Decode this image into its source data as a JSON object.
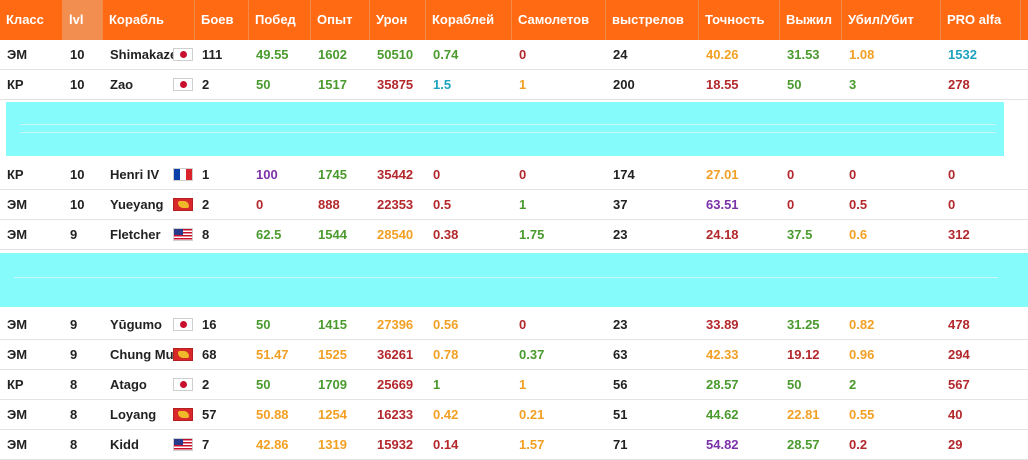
{
  "header": [
    "Класс",
    "lvl",
    "Корабль",
    "Боев",
    "Побед",
    "Опыт",
    "Урон",
    "Кораблей",
    "Самолетов",
    "выстрелов",
    "Точность",
    "Выжил",
    "Убил/Убит",
    "PRO alfa"
  ],
  "rows": [
    {
      "cls": "ЭМ",
      "lvl": "10",
      "ship": "Shimakaze",
      "flag": "jp-flag",
      "battles": "111",
      "wins": "49.55",
      "xp": "1602",
      "dmg": "50510",
      "ships": "0.74",
      "planes": "0",
      "shots": "24",
      "acc": "40.26",
      "surv": "31.53",
      "kd": "1.08",
      "pro": "1532"
    },
    {
      "cls": "КР",
      "lvl": "10",
      "ship": "Zao",
      "flag": "jp-flag",
      "battles": "2",
      "wins": "50",
      "xp": "1517",
      "dmg": "35875",
      "ships": "1.5",
      "planes": "1",
      "shots": "200",
      "acc": "18.55",
      "surv": "50",
      "kd": "3",
      "pro": "278"
    },
    {
      "cls": "КР",
      "lvl": "10",
      "ship": "Henri IV",
      "flag": "fr-flag",
      "battles": "1",
      "wins": "100",
      "xp": "1745",
      "dmg": "35442",
      "ships": "0",
      "planes": "0",
      "shots": "174",
      "acc": "27.01",
      "surv": "0",
      "kd": "0",
      "pro": "0"
    },
    {
      "cls": "ЭМ",
      "lvl": "10",
      "ship": "Yueyang",
      "flag": "cn-flag",
      "battles": "2",
      "wins": "0",
      "xp": "888",
      "dmg": "22353",
      "ships": "0.5",
      "planes": "1",
      "shots": "37",
      "acc": "63.51",
      "surv": "0",
      "kd": "0.5",
      "pro": "0"
    },
    {
      "cls": "ЭМ",
      "lvl": "9",
      "ship": "Fletcher",
      "flag": "us-flag",
      "battles": "8",
      "wins": "62.5",
      "xp": "1544",
      "dmg": "28540",
      "ships": "0.38",
      "planes": "1.75",
      "shots": "23",
      "acc": "24.18",
      "surv": "37.5",
      "kd": "0.6",
      "pro": "312"
    },
    {
      "cls": "ЭМ",
      "lvl": "9",
      "ship": "Yūgumo",
      "flag": "jp-flag",
      "battles": "16",
      "wins": "50",
      "xp": "1415",
      "dmg": "27396",
      "ships": "0.56",
      "planes": "0",
      "shots": "23",
      "acc": "33.89",
      "surv": "31.25",
      "kd": "0.82",
      "pro": "478"
    },
    {
      "cls": "ЭМ",
      "lvl": "9",
      "ship": "Chung Mu",
      "flag": "cn-flag",
      "battles": "68",
      "wins": "51.47",
      "xp": "1525",
      "dmg": "36261",
      "ships": "0.78",
      "planes": "0.37",
      "shots": "63",
      "acc": "42.33",
      "surv": "19.12",
      "kd": "0.96",
      "pro": "294"
    },
    {
      "cls": "КР",
      "lvl": "8",
      "ship": "Atago",
      "flag": "jp-flag",
      "battles": "2",
      "wins": "50",
      "xp": "1709",
      "dmg": "25669",
      "ships": "1",
      "planes": "1",
      "shots": "56",
      "acc": "28.57",
      "surv": "50",
      "kd": "2",
      "pro": "567"
    },
    {
      "cls": "ЭМ",
      "lvl": "8",
      "ship": "Loyang",
      "flag": "cn-flag",
      "battles": "57",
      "wins": "50.88",
      "xp": "1254",
      "dmg": "16233",
      "ships": "0.42",
      "planes": "0.21",
      "shots": "51",
      "acc": "44.62",
      "surv": "22.81",
      "kd": "0.55",
      "pro": "40"
    },
    {
      "cls": "ЭМ",
      "lvl": "8",
      "ship": "Kidd",
      "flag": "us-flag",
      "battles": "7",
      "wins": "42.86",
      "xp": "1319",
      "dmg": "15932",
      "ships": "0.14",
      "planes": "1.57",
      "shots": "71",
      "acc": "54.82",
      "surv": "28.57",
      "kd": "0.2",
      "pro": "29"
    }
  ],
  "colors": {
    "header_bg": "#ff6a13",
    "header_text": "#ffffff",
    "green": "#4a9a2e",
    "darkred": "#b3282d",
    "orange": "#f2a024",
    "purple": "#7b32a8",
    "teal": "#1ea3bf",
    "glitch": "#86fbfb"
  },
  "cell_colors": [
    {
      "wins": "green",
      "xp": "green",
      "dmg": "green",
      "ships": "green",
      "planes": "darkred",
      "acc": "orange",
      "surv": "green",
      "kd": "orange",
      "pro": "teal"
    },
    {
      "wins": "green",
      "xp": "green",
      "dmg": "darkred",
      "ships": "teal",
      "planes": "orange",
      "acc": "darkred",
      "surv": "green",
      "kd": "green",
      "pro": "darkred"
    },
    {
      "wins": "purple",
      "xp": "green",
      "dmg": "darkred",
      "ships": "darkred",
      "planes": "darkred",
      "acc": "orange",
      "surv": "darkred",
      "kd": "darkred",
      "pro": "darkred"
    },
    {
      "wins": "darkred",
      "xp": "darkred",
      "dmg": "darkred",
      "ships": "darkred",
      "planes": "green",
      "acc": "purple",
      "surv": "darkred",
      "kd": "darkred",
      "pro": "darkred"
    },
    {
      "wins": "green",
      "xp": "green",
      "dmg": "orange",
      "ships": "darkred",
      "planes": "green",
      "acc": "darkred",
      "surv": "green",
      "kd": "orange",
      "pro": "darkred"
    },
    {
      "wins": "green",
      "xp": "green",
      "dmg": "orange",
      "ships": "orange",
      "planes": "darkred",
      "acc": "darkred",
      "surv": "green",
      "kd": "orange",
      "pro": "darkred"
    },
    {
      "wins": "orange",
      "xp": "orange",
      "dmg": "darkred",
      "ships": "orange",
      "planes": "green",
      "acc": "orange",
      "surv": "darkred",
      "kd": "orange",
      "pro": "darkred"
    },
    {
      "wins": "green",
      "xp": "green",
      "dmg": "darkred",
      "ships": "green",
      "planes": "orange",
      "acc": "green",
      "surv": "green",
      "kd": "green",
      "pro": "darkred"
    },
    {
      "wins": "orange",
      "xp": "orange",
      "dmg": "darkred",
      "ships": "orange",
      "planes": "orange",
      "acc": "green",
      "surv": "orange",
      "kd": "orange",
      "pro": "darkred"
    },
    {
      "wins": "orange",
      "xp": "orange",
      "dmg": "darkred",
      "ships": "darkred",
      "planes": "orange",
      "acc": "purple",
      "surv": "green",
      "kd": "darkred",
      "pro": "darkred"
    }
  ]
}
